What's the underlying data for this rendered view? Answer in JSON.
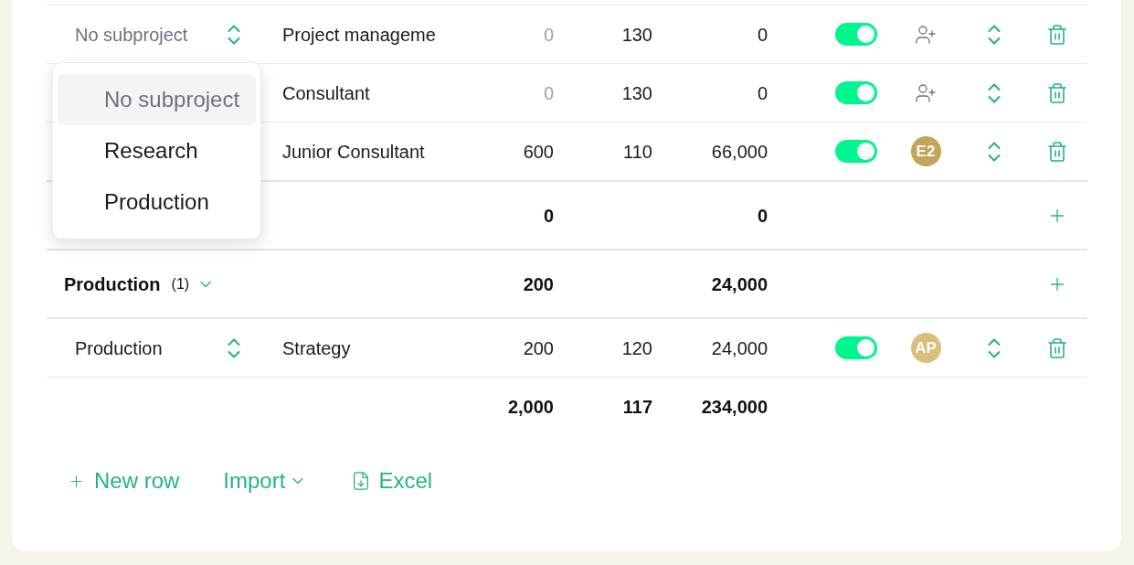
{
  "table": {
    "rows": [
      {
        "kind": "item",
        "subproject": {
          "placeholder": "No subproject"
        },
        "role": "Project manageme",
        "hours": {
          "text": "0",
          "muted": true
        },
        "rate": "130",
        "amount": "0",
        "enabled": true,
        "assignee": {
          "kind": "add"
        }
      },
      {
        "kind": "item",
        "role": "Consultant",
        "hours": {
          "text": "0",
          "muted": true
        },
        "rate": "130",
        "amount": "0",
        "enabled": true,
        "assignee": {
          "kind": "add"
        }
      },
      {
        "kind": "item",
        "role": "Junior Consultant",
        "hours": {
          "text": "600",
          "muted": false
        },
        "rate": "110",
        "amount": "66,000",
        "enabled": true,
        "assignee": {
          "kind": "avatar",
          "initials": "E2",
          "color": "#c4a35a"
        }
      },
      {
        "kind": "group",
        "hours": "0",
        "amount": "0"
      },
      {
        "kind": "group",
        "name": "Production",
        "count": "(1)",
        "expanded": true,
        "hours": "200",
        "amount": "24,000"
      },
      {
        "kind": "item",
        "subproject": {
          "value": "Production"
        },
        "role": "Strategy",
        "hours": {
          "text": "200",
          "muted": false
        },
        "rate": "120",
        "amount": "24,000",
        "enabled": true,
        "assignee": {
          "kind": "avatar",
          "initials": "AP",
          "color": "#d9bf7c"
        }
      },
      {
        "kind": "total",
        "hours": "2,000",
        "rate": "117",
        "amount": "234,000"
      }
    ]
  },
  "subproject_menu": {
    "options": [
      {
        "label": "No subproject",
        "selected": true
      },
      {
        "label": "Research",
        "selected": false
      },
      {
        "label": "Production",
        "selected": false
      }
    ]
  },
  "actions": [
    {
      "kind": "add",
      "label": "New row"
    },
    {
      "kind": "menu",
      "label": "Import"
    },
    {
      "kind": "export",
      "label": "Excel"
    }
  ]
}
